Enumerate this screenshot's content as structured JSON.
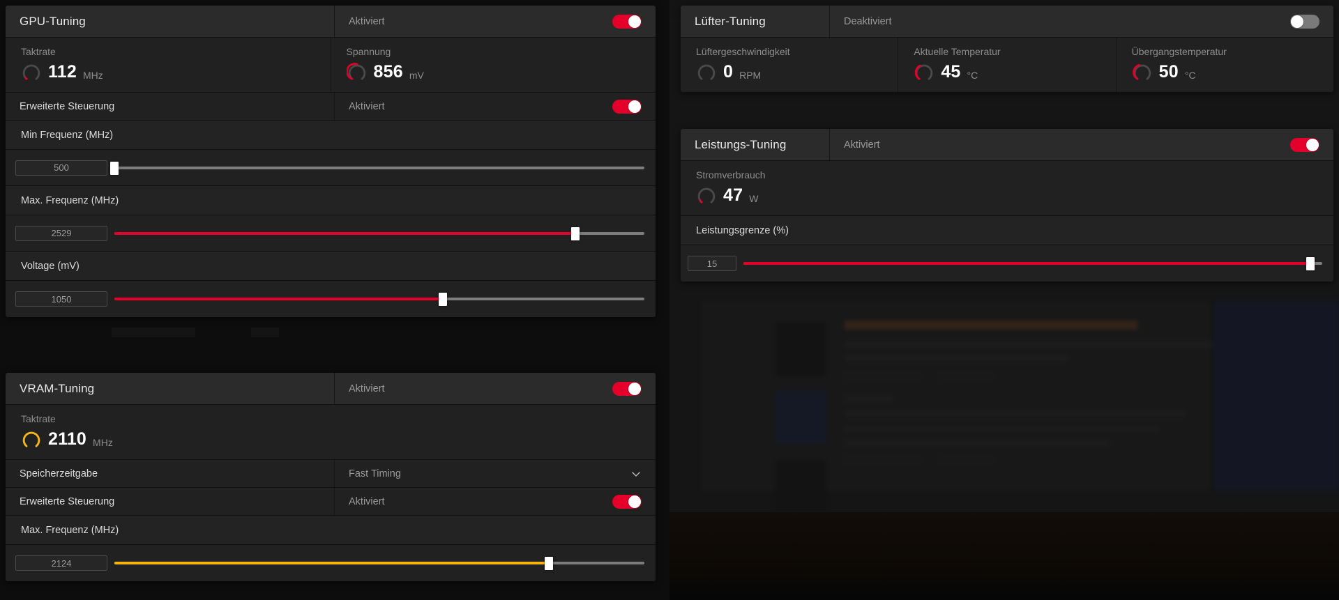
{
  "accent": {
    "red": "#e4002b",
    "yellow": "#f5b513",
    "track_gray": "#7d7d7d",
    "panel_bg": "#212121",
    "header_bg": "#2b2b2b"
  },
  "panels": {
    "gpu": {
      "title": "GPU-Tuning",
      "state": "Aktiviert",
      "toggle_on": true,
      "metrics": [
        {
          "label": "Taktrate",
          "value": "112",
          "unit": "MHz",
          "gauge_color": "#e4002b",
          "gauge_pct": 4
        },
        {
          "label": "Spannung",
          "value": "856",
          "unit": "mV",
          "gauge_color": "#e4002b",
          "gauge_pct": 46
        }
      ],
      "advanced": {
        "label": "Erweiterte Steuerung",
        "state": "Aktiviert",
        "toggle_on": true
      },
      "sliders": [
        {
          "label": "Min Frequenz (MHz)",
          "value": "500",
          "pct": 0,
          "fill_color": "#e4002b"
        },
        {
          "label": "Max. Frequenz (MHz)",
          "value": "2529",
          "pct": 87,
          "fill_color": "#e4002b"
        },
        {
          "label": "Voltage (mV)",
          "value": "1050",
          "pct": 62,
          "fill_color": "#e4002b"
        }
      ]
    },
    "vram": {
      "title": "VRAM-Tuning",
      "state": "Aktiviert",
      "toggle_on": true,
      "metrics": [
        {
          "label": "Taktrate",
          "value": "2110",
          "unit": "MHz",
          "gauge_color": "#f5b513",
          "gauge_pct": 100
        }
      ],
      "timing": {
        "label": "Speicherzeitgabe",
        "value": "Fast Timing"
      },
      "advanced": {
        "label": "Erweiterte Steuerung",
        "state": "Aktiviert",
        "toggle_on": true
      },
      "sliders": [
        {
          "label": "Max. Frequenz (MHz)",
          "value": "2124",
          "pct": 82,
          "fill_color": "#f5b513"
        }
      ]
    },
    "fan": {
      "title": "Lüfter-Tuning",
      "state": "Deaktiviert",
      "toggle_on": false,
      "metrics": [
        {
          "label": "Lüftergeschwindigkeit",
          "value": "0",
          "unit": "RPM",
          "gauge_color": "#e4002b",
          "gauge_pct": 0
        },
        {
          "label": "Aktuelle Temperatur",
          "value": "45",
          "unit": "°C",
          "gauge_color": "#e4002b",
          "gauge_pct": 33
        },
        {
          "label": "Übergangstemperatur",
          "value": "50",
          "unit": "°C",
          "gauge_color": "#e4002b",
          "gauge_pct": 37
        }
      ]
    },
    "power": {
      "title": "Leistungs-Tuning",
      "state": "Aktiviert",
      "toggle_on": true,
      "metrics": [
        {
          "label": "Stromverbrauch",
          "value": "47",
          "unit": "W",
          "gauge_color": "#e4002b",
          "gauge_pct": 6
        }
      ],
      "sliders": [
        {
          "label": "Leistungsgrenze (%)",
          "value": "15",
          "pct": 98,
          "fill_color": "#e4002b"
        }
      ]
    }
  }
}
